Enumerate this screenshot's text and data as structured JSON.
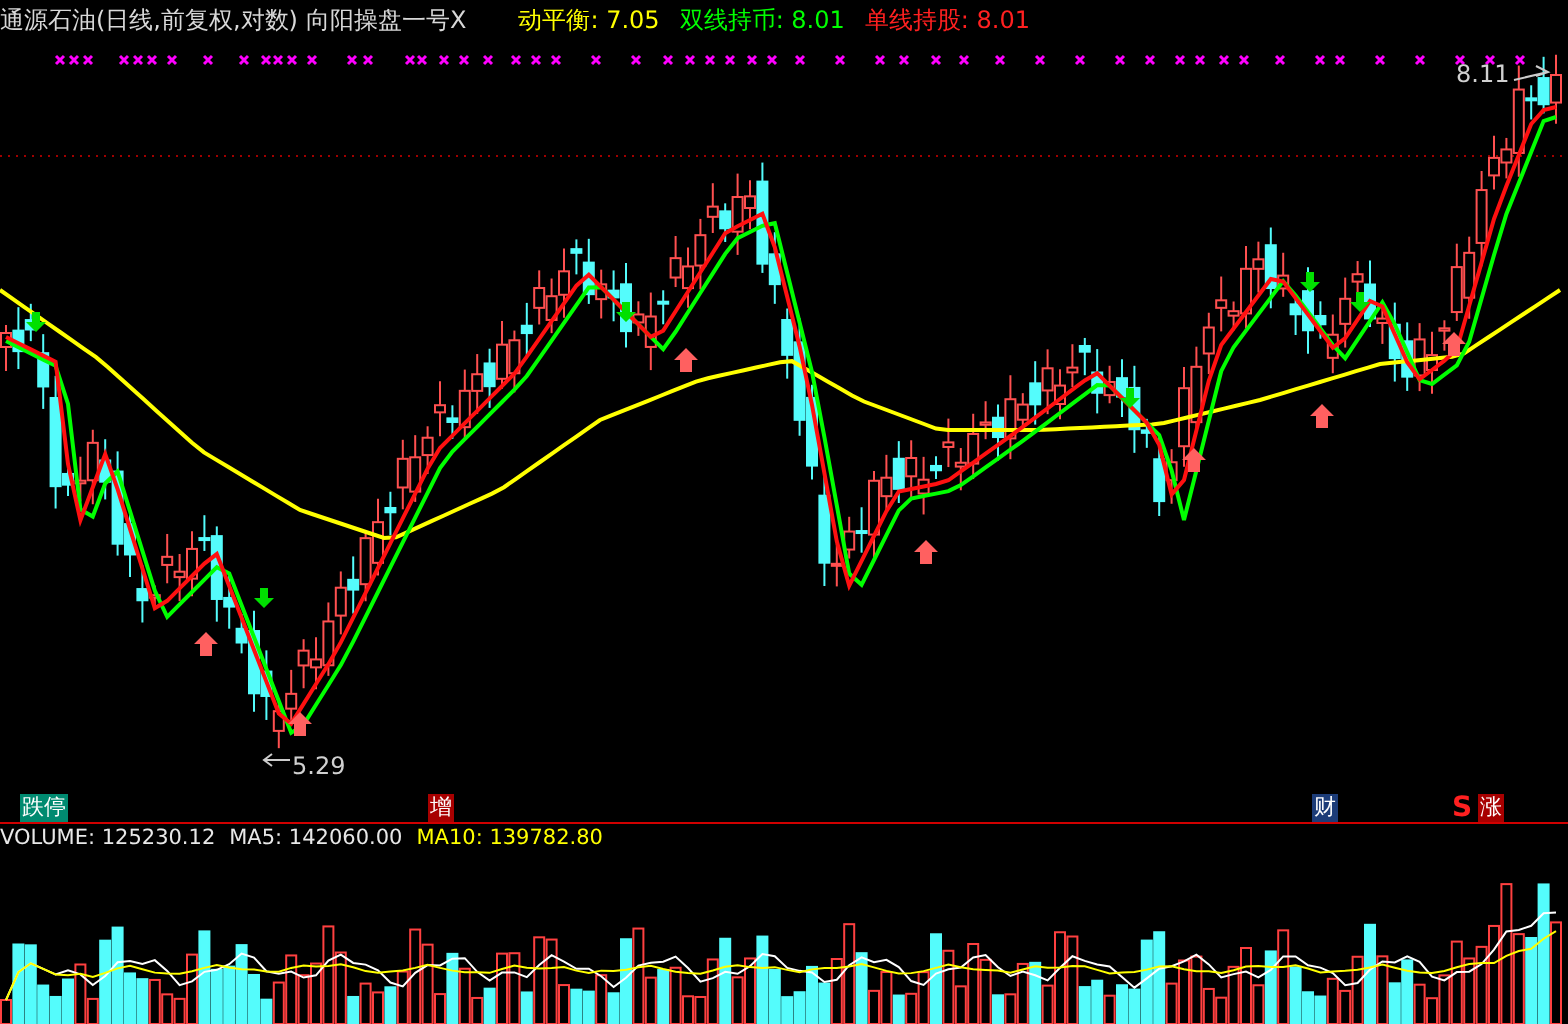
{
  "title": {
    "stock": "通源石油(日线,前复权,对数)",
    "indicator": "向阳操盘一号",
    "close_mark": "X"
  },
  "legend": [
    {
      "text": "动平衡: 7.05",
      "color": "#ffff00"
    },
    {
      "text": "双线持币: 8.01",
      "color": "#00ff00"
    },
    {
      "text": "单线持股: 8.01",
      "color": "#ff2020"
    }
  ],
  "price_labels": [
    {
      "text": "8.11",
      "kind": "high"
    },
    {
      "text": "5.29",
      "kind": "low"
    }
  ],
  "event_tags": [
    {
      "text": "跌停",
      "kind": "badge",
      "color": "#008a70"
    },
    {
      "text": "增",
      "kind": "badge",
      "color": "#a80000"
    },
    {
      "text": "财",
      "kind": "badge",
      "color": "#1c3c78"
    },
    {
      "text": "S",
      "kind": "mark",
      "color": "#ff2020"
    },
    {
      "text": "涨",
      "kind": "badge",
      "color": "#a80000"
    }
  ],
  "volume_legend": [
    {
      "text": "VOLUME: 125230.12",
      "color": "#e8e8e8"
    },
    {
      "text": "MA5: 142060.00",
      "color": "#e8e8e8"
    },
    {
      "text": "MA10: 139782.80",
      "color": "#ffff00"
    }
  ]
}
